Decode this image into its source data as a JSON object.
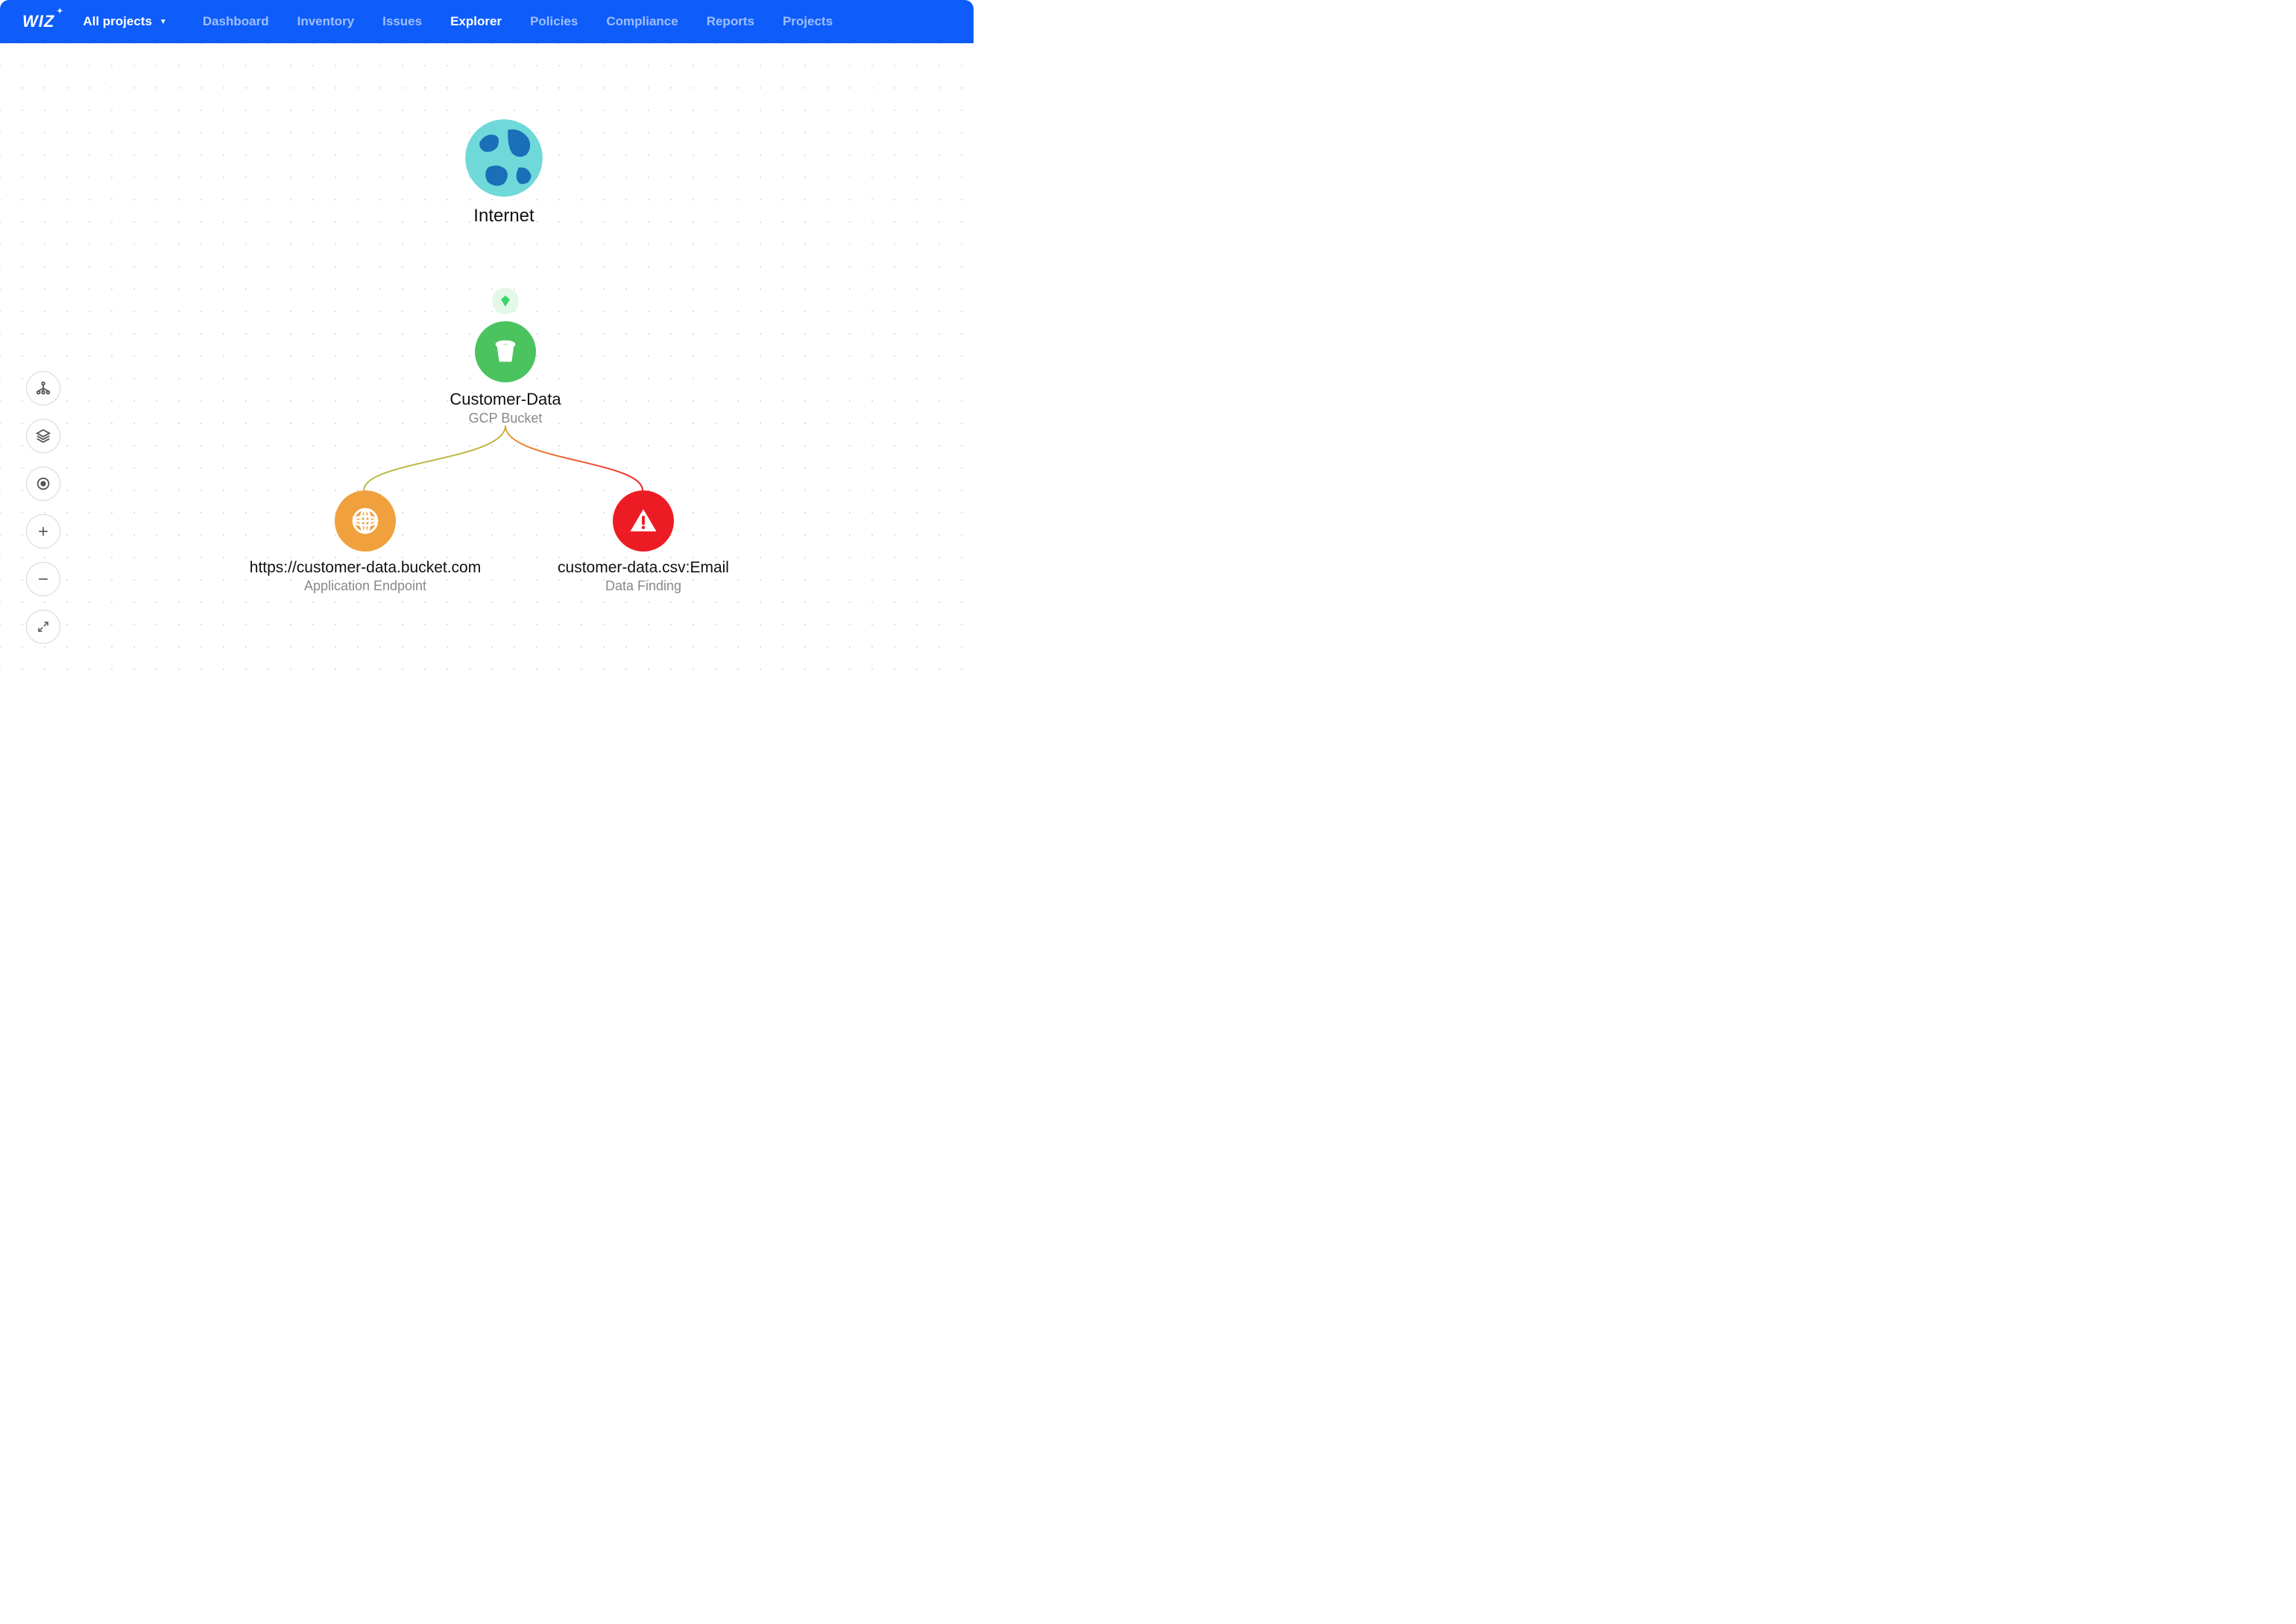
{
  "header": {
    "logo": "WIZ",
    "project_selector": "All projects",
    "nav": [
      {
        "label": "Dashboard",
        "active": false
      },
      {
        "label": "Inventory",
        "active": false
      },
      {
        "label": "Issues",
        "active": false
      },
      {
        "label": "Explorer",
        "active": true
      },
      {
        "label": "Policies",
        "active": false
      },
      {
        "label": "Compliance",
        "active": false
      },
      {
        "label": "Reports",
        "active": false
      },
      {
        "label": "Projects",
        "active": false
      }
    ]
  },
  "toolbar": {
    "icons": [
      "graph-icon",
      "layers-icon",
      "target-icon",
      "plus-icon",
      "minus-icon",
      "expand-icon"
    ]
  },
  "graph": {
    "nodes": {
      "internet": {
        "title": "Internet",
        "subtitle": "",
        "icon": "globe-earth-icon",
        "color": "#1a7fc0"
      },
      "bucket": {
        "title": "Customer-Data",
        "subtitle": "GCP Bucket",
        "icon": "bucket-icon",
        "color": "#4bc35f"
      },
      "endpoint": {
        "title": "https://customer-data.bucket.com",
        "subtitle": "Application Endpoint",
        "icon": "globe-grid-icon",
        "color": "#f0a03c"
      },
      "finding": {
        "title": "customer-data.csv:Email",
        "subtitle": "Data Finding",
        "icon": "alert-triangle-icon",
        "color": "#ed1c24"
      }
    },
    "badge": {
      "icon": "diamond-icon",
      "color": "#3fd46b"
    }
  }
}
